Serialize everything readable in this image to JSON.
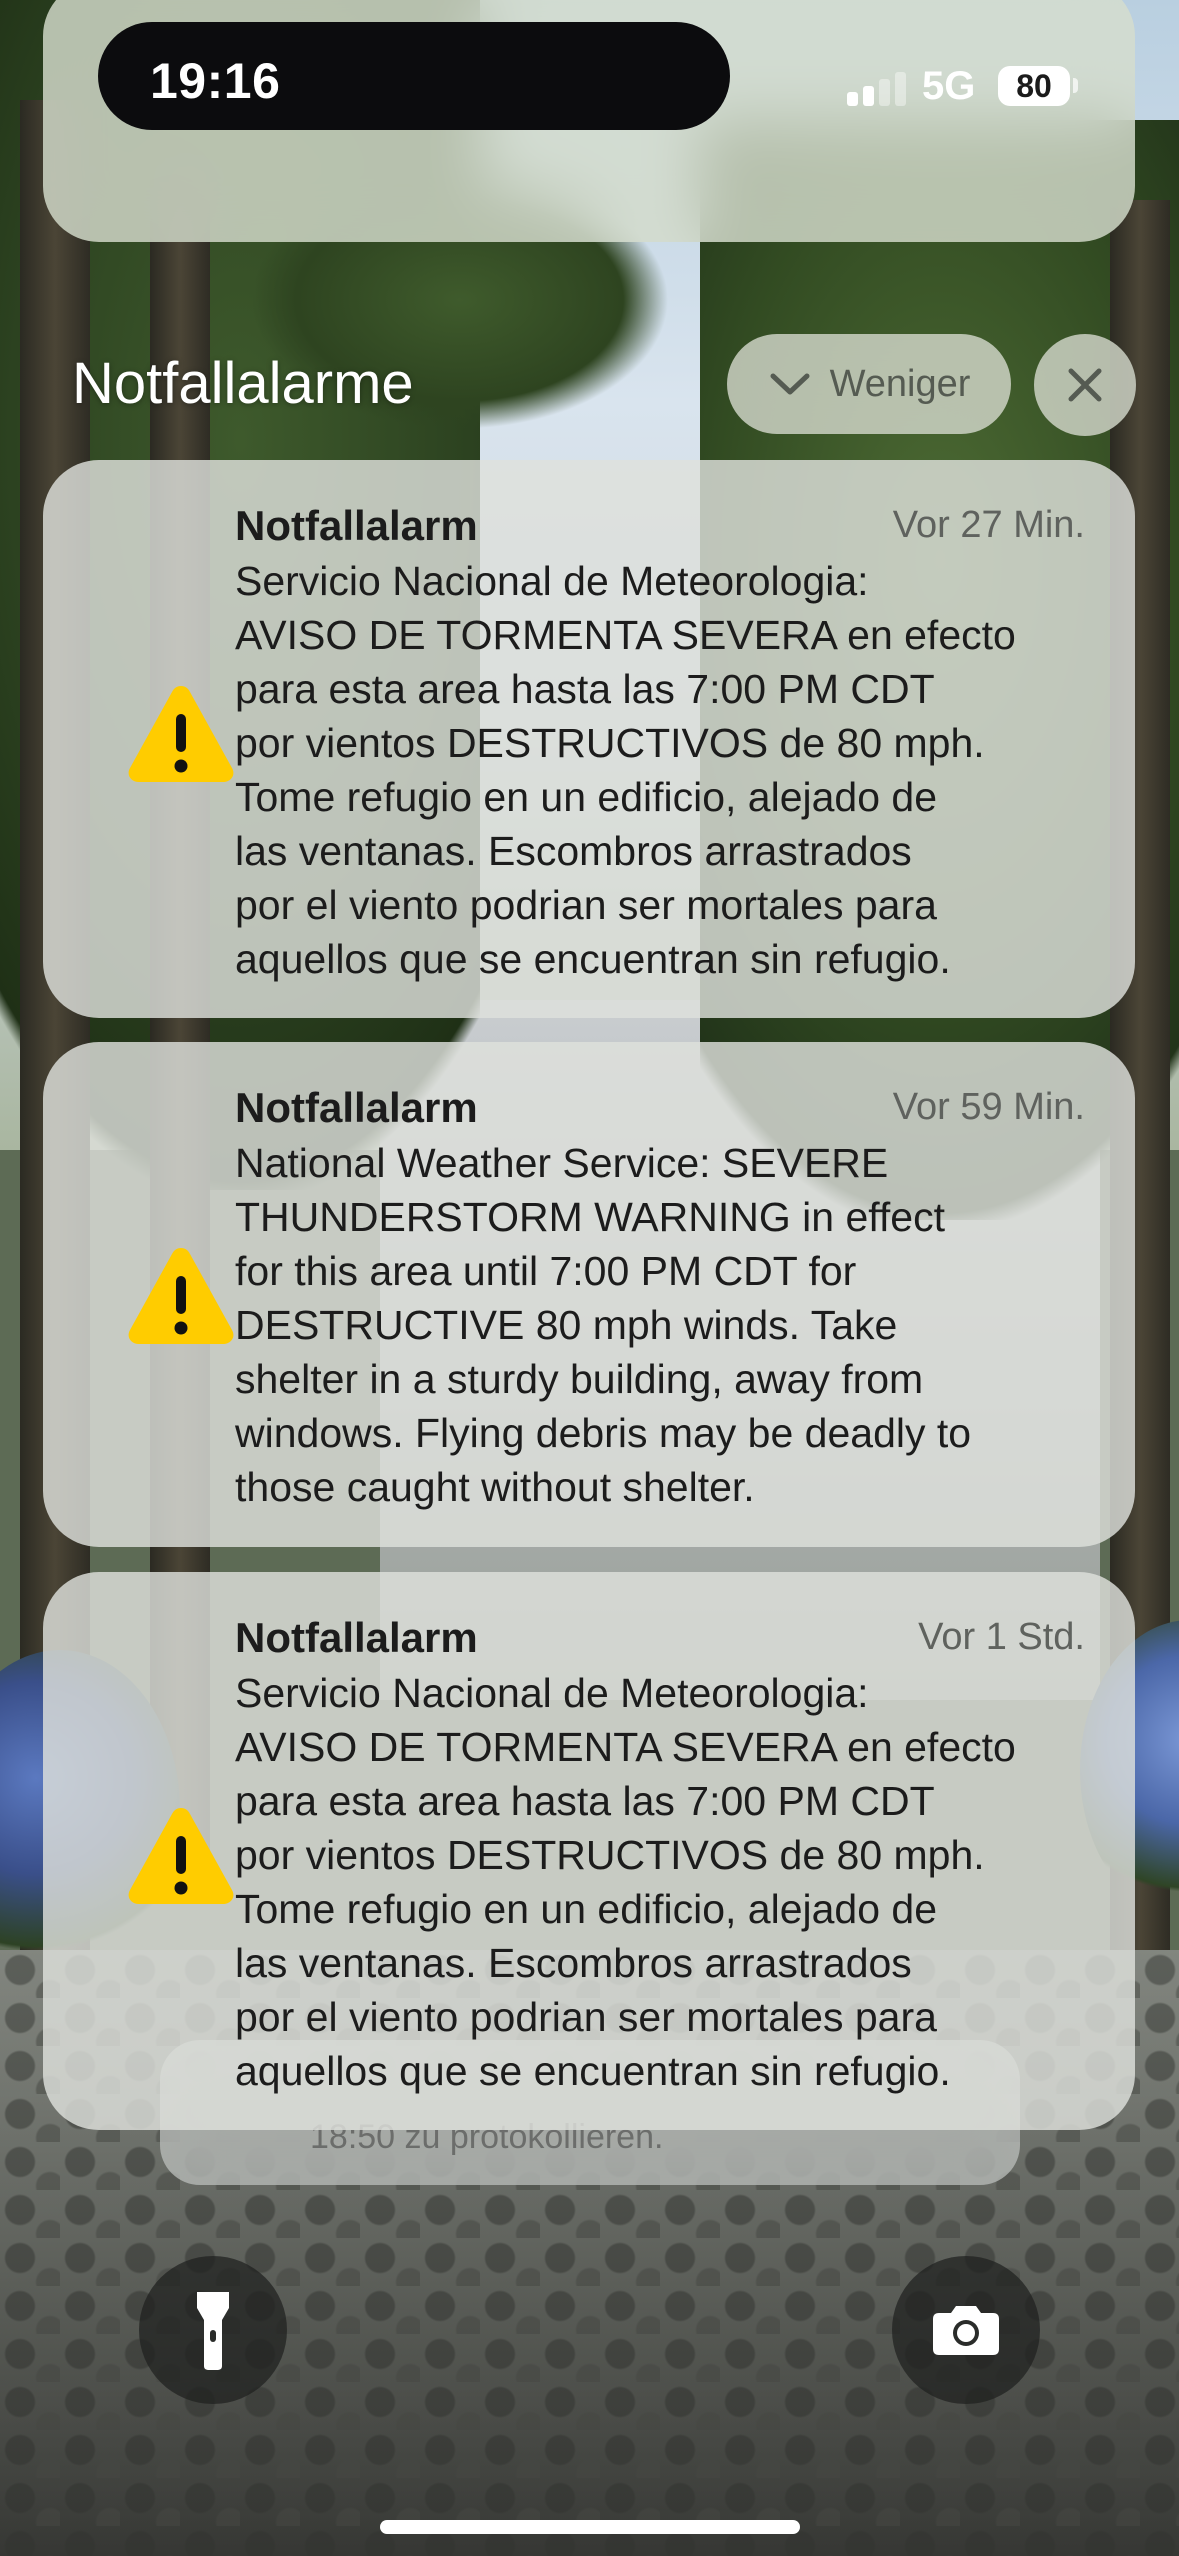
{
  "status_bar": {
    "time": "19:16",
    "network": "5G",
    "battery": "80",
    "signal_bars_active": 2
  },
  "group": {
    "title": "Notfallalarme",
    "collapse_label": "Weniger",
    "collapse_icon": "chevron-down-icon",
    "close_icon": "close-icon"
  },
  "notifications": [
    {
      "app": "Notfallalarm",
      "time": "Vor 27 Min.",
      "icon": "warning-triangle-icon",
      "lines": [
        "Servicio Nacional de Meteorologia:",
        "AVISO DE TORMENTA SEVERA en efecto",
        "para esta area hasta las 7:00 PM CDT",
        "por vientos DESTRUCTIVOS de 80 mph.",
        "Tome refugio en un edificio, alejado de",
        "las ventanas. Escombros arrastrados",
        "por el viento podrian ser mortales para",
        "aquellos que se encuentran sin refugio."
      ]
    },
    {
      "app": "Notfallalarm",
      "time": "Vor 59 Min.",
      "icon": "warning-triangle-icon",
      "lines": [
        "National Weather Service: SEVERE",
        "THUNDERSTORM WARNING in effect",
        "for this area until 7:00 PM CDT for",
        "DESTRUCTIVE 80 mph winds. Take",
        "shelter in a sturdy building, away from",
        "windows. Flying debris may be deadly to",
        "those caught without shelter."
      ]
    },
    {
      "app": "Notfallalarm",
      "time": "Vor 1 Std.",
      "icon": "warning-triangle-icon",
      "lines": [
        "Servicio Nacional de Meteorologia:",
        "AVISO DE TORMENTA SEVERA en efecto",
        "para esta area hasta las 7:00 PM CDT",
        "por vientos DESTRUCTIVOS de 80 mph.",
        "Tome refugio en un edificio, alejado de",
        "las ventanas. Escombros arrastrados",
        "por el viento podrian ser mortales para",
        "aquellos que se encuentran sin refugio."
      ]
    }
  ],
  "stacked_notification_peek": "18:50 zu protokollieren.",
  "controls": {
    "left_icon": "flashlight-icon",
    "right_icon": "camera-icon"
  },
  "colors": {
    "warning_yellow": "#FFCC00",
    "card_glass": "rgba(222,225,220,0.82)",
    "text_primary": "#1C1C1C",
    "text_secondary": "#5F625E"
  }
}
